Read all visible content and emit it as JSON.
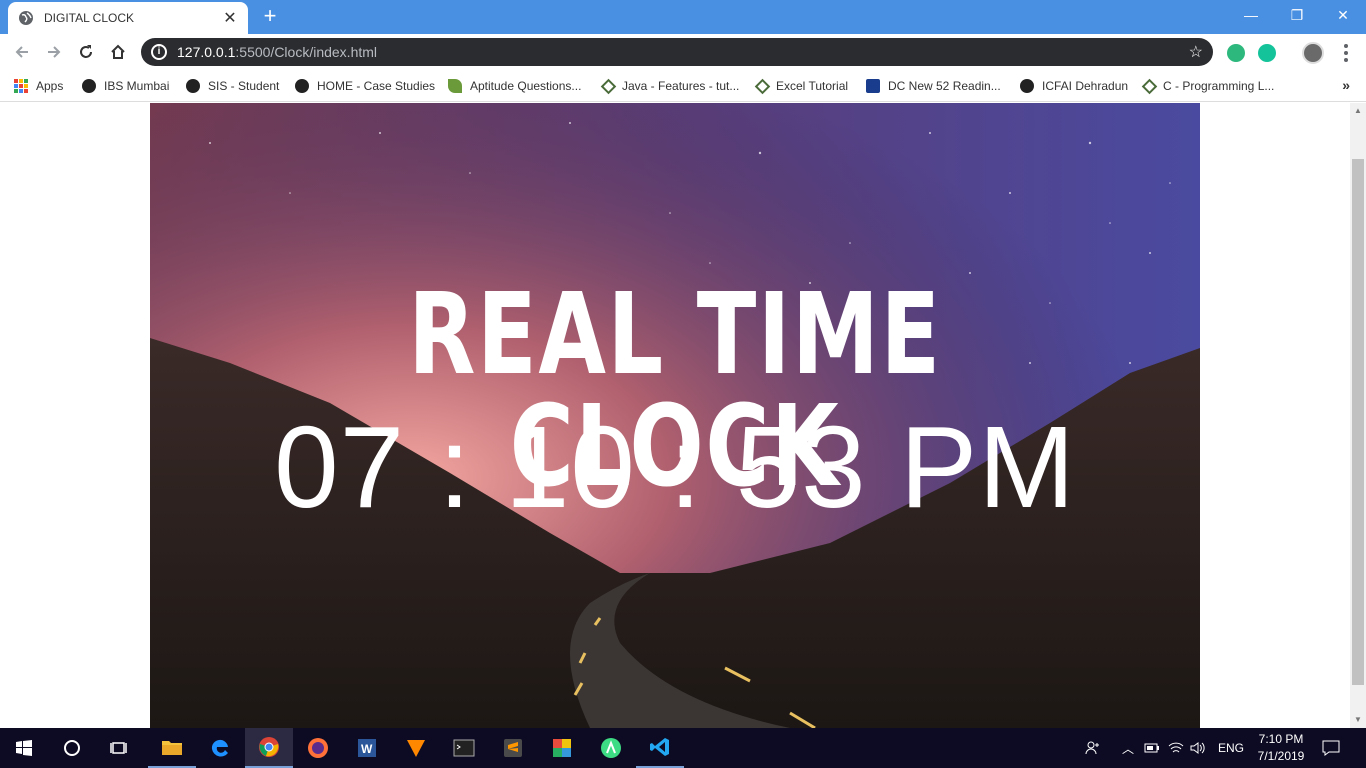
{
  "browser": {
    "tab_title": "DIGITAL CLOCK",
    "url_host": "127.0.0.1",
    "url_path": ":5500/Clock/index.html"
  },
  "bookmarks": [
    {
      "label": "Apps",
      "icon": "apps-grid-icon"
    },
    {
      "label": "IBS Mumbai",
      "icon": "globe-icon"
    },
    {
      "label": "SIS - Student",
      "icon": "globe-icon"
    },
    {
      "label": "HOME - Case Studies",
      "icon": "globe-icon"
    },
    {
      "label": "Aptitude Questions...",
      "icon": "leaf-icon"
    },
    {
      "label": "Java - Features - tut...",
      "icon": "diamond-icon"
    },
    {
      "label": "Excel Tutorial",
      "icon": "diamond-icon"
    },
    {
      "label": "DC New 52 Readin...",
      "icon": "dc-icon"
    },
    {
      "label": "ICFAI Dehradun",
      "icon": "globe-icon"
    },
    {
      "label": "C - Programming L...",
      "icon": "diamond-icon"
    }
  ],
  "page": {
    "title": "REAL TIME CLOCK",
    "time": "07 : 10 : 53 PM"
  },
  "taskbar": {
    "language": "ENG",
    "time": "7:10 PM",
    "date": "7/1/2019"
  },
  "colors": {
    "titlebar": "#4a90e2",
    "taskbar": "#0d0b23",
    "accent": "#7aa0d8"
  }
}
